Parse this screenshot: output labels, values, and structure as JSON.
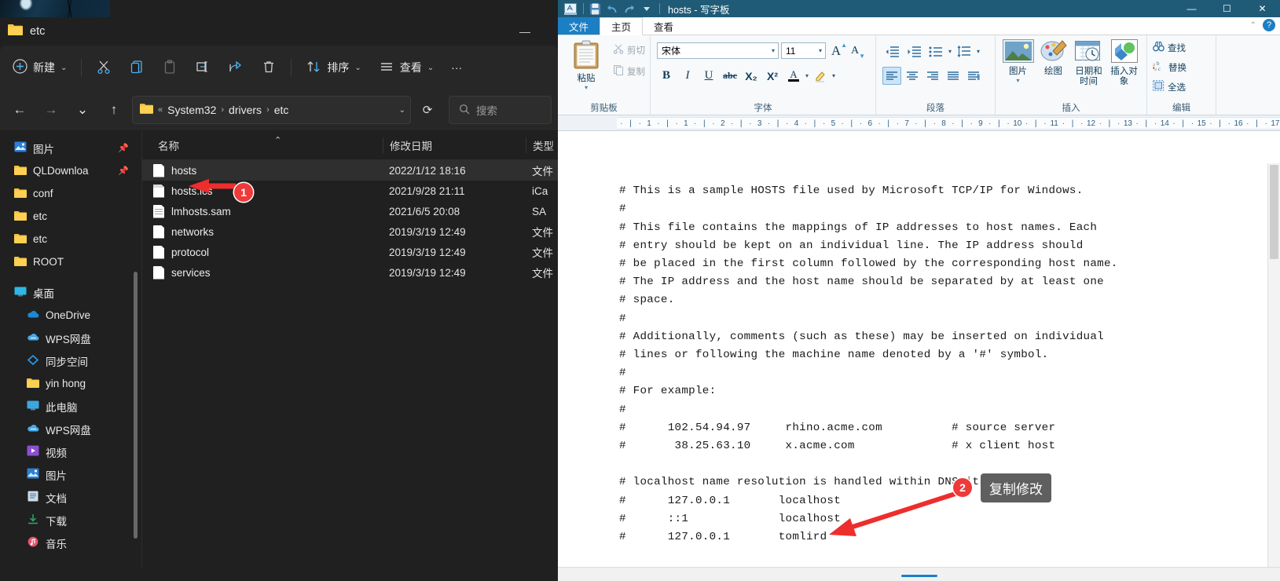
{
  "explorer": {
    "window_title": "etc",
    "minimize_label": "—",
    "toolbar": {
      "new_label": "新建",
      "sort_label": "排序",
      "view_label": "查看",
      "cut_tooltip": "剪切",
      "copy_tooltip": "复制",
      "paste_tooltip": "粘贴",
      "rename_tooltip": "重命名",
      "share_tooltip": "共享",
      "delete_tooltip": "删除",
      "more_label": "···"
    },
    "address": {
      "back": "←",
      "forward": "→",
      "recent": "⌄",
      "up": "↑",
      "prefix": "«",
      "crumbs": [
        "System32",
        "drivers",
        "etc"
      ],
      "separator": "›",
      "dropdown": "⌄",
      "refresh": "⟳"
    },
    "search": {
      "placeholder": "搜索"
    },
    "nav_items": [
      {
        "label": "图片",
        "icon": "pictures-icon",
        "pinned": true,
        "indent": false
      },
      {
        "label": "QLDownloa",
        "icon": "folder-icon",
        "pinned": true,
        "indent": false
      },
      {
        "label": "conf",
        "icon": "folder-icon",
        "pinned": false,
        "indent": false
      },
      {
        "label": "etc",
        "icon": "folder-icon",
        "pinned": false,
        "indent": false
      },
      {
        "label": "etc",
        "icon": "folder-icon",
        "pinned": false,
        "indent": false
      },
      {
        "label": "ROOT",
        "icon": "folder-icon",
        "pinned": false,
        "indent": false
      },
      {
        "label": "桌面",
        "icon": "desktop-icon",
        "pinned": false,
        "indent": false
      },
      {
        "label": "OneDrive",
        "icon": "onedrive-icon",
        "pinned": false,
        "indent": true
      },
      {
        "label": "WPS网盘",
        "icon": "wps-cloud-icon",
        "pinned": false,
        "indent": true
      },
      {
        "label": "同步空间",
        "icon": "sync-space-icon",
        "pinned": false,
        "indent": true
      },
      {
        "label": "yin hong",
        "icon": "folder-icon",
        "pinned": false,
        "indent": true
      },
      {
        "label": "此电脑",
        "icon": "this-pc-icon",
        "pinned": false,
        "indent": true
      },
      {
        "label": "WPS网盘",
        "icon": "wps-cloud-icon",
        "pinned": false,
        "indent": true
      },
      {
        "label": "视频",
        "icon": "videos-icon",
        "pinned": false,
        "indent": true
      },
      {
        "label": "图片",
        "icon": "pictures-icon",
        "pinned": false,
        "indent": true
      },
      {
        "label": "文档",
        "icon": "documents-icon",
        "pinned": false,
        "indent": true
      },
      {
        "label": "下载",
        "icon": "downloads-icon",
        "pinned": false,
        "indent": true
      },
      {
        "label": "音乐",
        "icon": "music-icon",
        "pinned": false,
        "indent": true
      }
    ],
    "columns": {
      "name": "名称",
      "date": "修改日期",
      "type": "类型"
    },
    "files": [
      {
        "name": "hosts",
        "date": "2022/1/12 18:16",
        "type": "文件",
        "icon": "file-icon",
        "selected": true
      },
      {
        "name": "hosts.ics",
        "date": "2021/9/28 21:11",
        "type": "iCa",
        "icon": "calendar-icon",
        "selected": false
      },
      {
        "name": "lmhosts.sam",
        "date": "2021/6/5 20:08",
        "type": "SA",
        "icon": "text-file-icon",
        "selected": false
      },
      {
        "name": "networks",
        "date": "2019/3/19 12:49",
        "type": "文件",
        "icon": "file-icon",
        "selected": false
      },
      {
        "name": "protocol",
        "date": "2019/3/19 12:49",
        "type": "文件",
        "icon": "file-icon",
        "selected": false
      },
      {
        "name": "services",
        "date": "2019/3/19 12:49",
        "type": "文件",
        "icon": "file-icon",
        "selected": false
      }
    ]
  },
  "wordpad": {
    "title": "hosts - 写字板",
    "quick_access": [
      "wordpad-icon",
      "save-icon",
      "undo-icon",
      "redo-icon",
      "customize-icon"
    ],
    "window_buttons": {
      "minimize": "—",
      "maximize": "☐",
      "close": "✕"
    },
    "tabs": [
      {
        "label": "文件",
        "kind": "file"
      },
      {
        "label": "主页",
        "kind": "active"
      },
      {
        "label": "查看",
        "kind": "normal"
      }
    ],
    "help": {
      "collapse": "⌃",
      "question": "?"
    },
    "ribbon": {
      "clipboard": {
        "group_label": "剪贴板",
        "paste_label": "粘贴",
        "cut_label": "剪切",
        "copy_label": "复制"
      },
      "font": {
        "group_label": "字体",
        "font_name": "宋体",
        "font_size": "11",
        "grow_label": "A",
        "shrink_label": "A",
        "bold": "B",
        "italic": "I",
        "underline": "U",
        "strike": "abc",
        "subscript": "X₂",
        "superscript": "X²",
        "text_color": "A",
        "highlight": "✏"
      },
      "paragraph": {
        "group_label": "段落",
        "decrease_indent": "decrease-indent-icon",
        "increase_indent": "increase-indent-icon",
        "bullets": "bullets-icon",
        "line_spacing": "line-spacing-icon",
        "align_left": "align-left-icon",
        "align_center": "align-center-icon",
        "align_right": "align-right-icon",
        "justify": "justify-icon",
        "paragraph_marks": "paragraph-marks-icon"
      },
      "insert": {
        "group_label": "插入",
        "picture_label": "图片",
        "paint_label": "绘图",
        "datetime_label": "日期和时间",
        "object_label": "插入对象"
      },
      "editing": {
        "group_label": "编辑",
        "find_label": "查找",
        "replace_label": "替换",
        "select_all_label": "全选"
      }
    },
    "ruler_ticks": [
      "1",
      "1",
      "2",
      "3",
      "4",
      "5",
      "6",
      "7",
      "8",
      "9",
      "10",
      "11",
      "12",
      "13",
      "14",
      "15",
      "16",
      "17"
    ],
    "document_lines": [
      "# This is a sample HOSTS file used by Microsoft TCP/IP for Windows.",
      "#",
      "# This file contains the mappings of IP addresses to host names. Each",
      "# entry should be kept on an individual line. The IP address should",
      "# be placed in the first column followed by the corresponding host name.",
      "# The IP address and the host name should be separated by at least one",
      "# space.",
      "#",
      "# Additionally, comments (such as these) may be inserted on individual",
      "# lines or following the machine name denoted by a '#' symbol.",
      "#",
      "# For example:",
      "#",
      "#      102.54.94.97     rhino.acme.com          # source server",
      "#       38.25.63.10     x.acme.com              # x client host",
      "",
      "# localhost name resolution is handled within DNS itself.",
      "#      127.0.0.1       localhost",
      "#      ::1             localhost",
      "#      127.0.0.1       tomlird"
    ]
  },
  "annotations": [
    {
      "id": "1",
      "marker": "1",
      "callout": null
    },
    {
      "id": "2",
      "marker": "2",
      "callout": "复制修改"
    }
  ],
  "colors": {
    "explorer_bg": "#202020",
    "explorer_toolbar": "#272727",
    "wordpad_title": "#1f5b77",
    "accent_blue": "#1b7fc4",
    "marker_red": "#ef3a3a",
    "callout_gray": "#5f5f5f"
  }
}
